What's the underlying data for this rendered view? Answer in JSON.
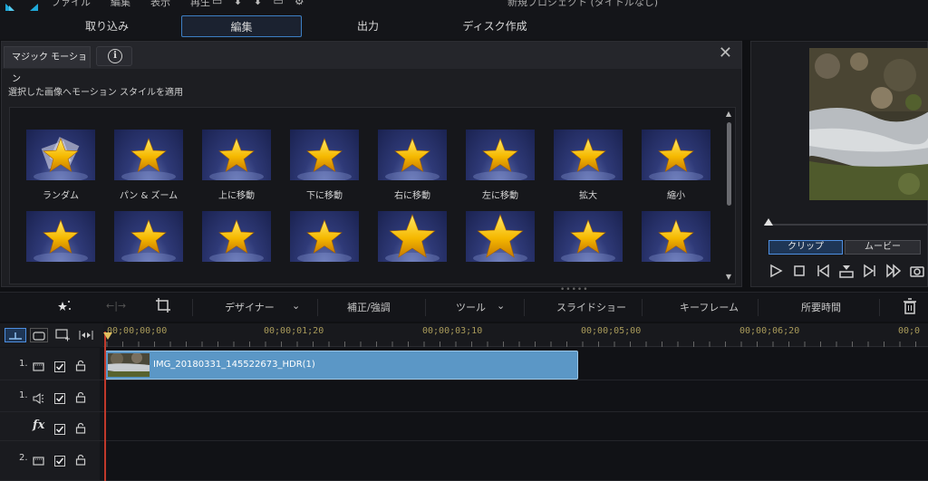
{
  "menubar": {
    "items": [
      "ファイル",
      "編集",
      "表示",
      "再生"
    ],
    "project_title": "新規プロジェクト (タイトルなし)"
  },
  "tabs": [
    {
      "label": "取り込み",
      "active": false
    },
    {
      "label": "編集",
      "active": true
    },
    {
      "label": "出力",
      "active": false
    },
    {
      "label": "ディスク作成",
      "active": false
    }
  ],
  "panel": {
    "title": "マジック モーション",
    "info_label": "i",
    "description": "選択した画像へモーション スタイルを適用"
  },
  "motions": [
    {
      "label": "ランダム",
      "icon": "random-star-icon"
    },
    {
      "label": "パン & ズーム",
      "icon": "star-icon"
    },
    {
      "label": "上に移動",
      "icon": "star-icon"
    },
    {
      "label": "下に移動",
      "icon": "star-icon"
    },
    {
      "label": "右に移動",
      "icon": "star-icon"
    },
    {
      "label": "左に移動",
      "icon": "star-icon"
    },
    {
      "label": "拡大",
      "icon": "star-icon"
    },
    {
      "label": "縮小",
      "icon": "star-icon"
    },
    {
      "label": "",
      "icon": "star-icon"
    },
    {
      "label": "",
      "icon": "star-icon"
    },
    {
      "label": "",
      "icon": "star-icon"
    },
    {
      "label": "",
      "icon": "star-icon"
    },
    {
      "label": "",
      "icon": "star-icon"
    },
    {
      "label": "",
      "icon": "star-icon"
    },
    {
      "label": "",
      "icon": "star-icon"
    },
    {
      "label": "",
      "icon": "star-icon"
    }
  ],
  "preview": {
    "mode_clip": "クリップ",
    "mode_movie": "ムービー"
  },
  "toolbar": {
    "designer": "デザイナー",
    "correct": "補正/強調",
    "tools": "ツール",
    "slideshow": "スライドショー",
    "keyframe": "キーフレーム",
    "duration": "所要時間"
  },
  "timeline": {
    "timecodes": [
      "00;00;00;00",
      "00;00;01;20",
      "00;00;03;10",
      "00;00;05;00",
      "00;00;06;20",
      "00;0"
    ],
    "tracks": [
      {
        "num": "1.",
        "type": "video"
      },
      {
        "num": "1.",
        "type": "audio"
      },
      {
        "num": "",
        "type": "fx"
      },
      {
        "num": "2.",
        "type": "video"
      }
    ],
    "clip_label": "IMG_20180331_145522673_HDR(1)"
  },
  "colors": {
    "accent": "#3d7fc4",
    "clip": "#5b97c6",
    "timecode": "#a89a5a"
  }
}
